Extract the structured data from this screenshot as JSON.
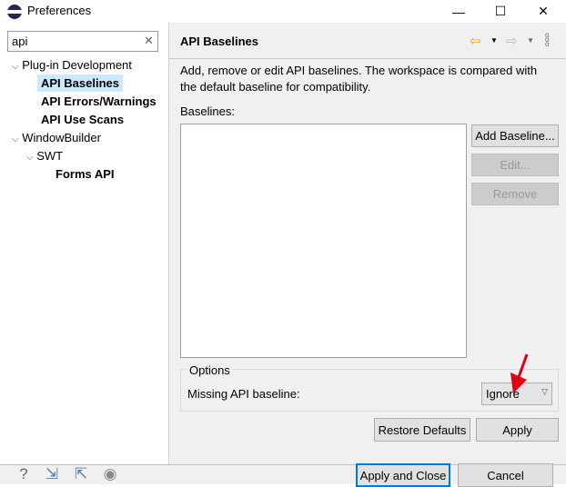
{
  "window": {
    "title": "Preferences",
    "minimize": "—",
    "maximize": "☐",
    "close": "✕"
  },
  "search": {
    "value": "api",
    "clear": "✕"
  },
  "tree": [
    {
      "label": "Plug-in Development",
      "chev": "⌵"
    },
    {
      "label": "API Baselines",
      "selected": true
    },
    {
      "label": "API Errors/Warnings"
    },
    {
      "label": "API Use Scans"
    },
    {
      "label": "WindowBuilder",
      "chev": "⌵"
    },
    {
      "label": "SWT",
      "chev": "⌵"
    },
    {
      "label": "Forms API"
    }
  ],
  "page": {
    "title": "API Baselines",
    "description": "Add, remove or edit API baselines. The workspace is compared with the default baseline for compatibility.",
    "baselines_label": "Baselines:",
    "add": "Add Baseline...",
    "edit": "Edit...",
    "remove": "Remove",
    "options_label": "Options",
    "missing_label": "Missing API baseline:",
    "missing_value": "Ignore",
    "restore": "Restore Defaults",
    "apply": "Apply"
  },
  "footer": {
    "apply_close": "Apply and Close",
    "cancel": "Cancel"
  },
  "colors": {
    "selection": "#cce8ff",
    "arrow_annotation": "#e00010",
    "back_arrow": "#e8a400"
  }
}
